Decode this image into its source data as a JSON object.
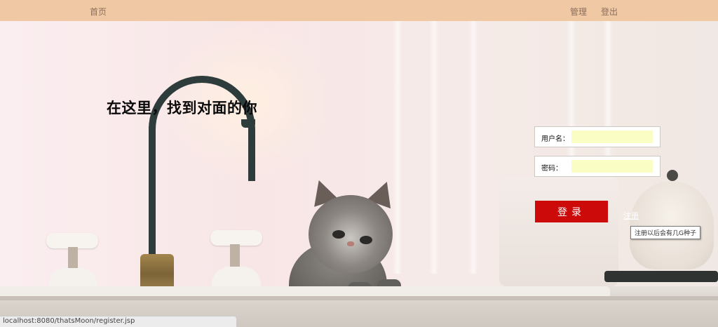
{
  "nav": {
    "home_label": "首页",
    "manage_label": "管理",
    "logout_label": "登出"
  },
  "headline": "在这里，找到对面的你",
  "login": {
    "username_label": "用户名：",
    "username_value": "",
    "password_label": "密码：",
    "password_value": "",
    "submit_label": "登录",
    "register_label": "注册",
    "register_tooltip": "注册以后会有几G种子"
  },
  "status_bar": {
    "url": "localhost:8080/thatsMoon/register.jsp"
  },
  "colors": {
    "topbar": "#f0c8a4",
    "login_button": "#cc0a0a",
    "input_autofill": "#fafdc4"
  }
}
